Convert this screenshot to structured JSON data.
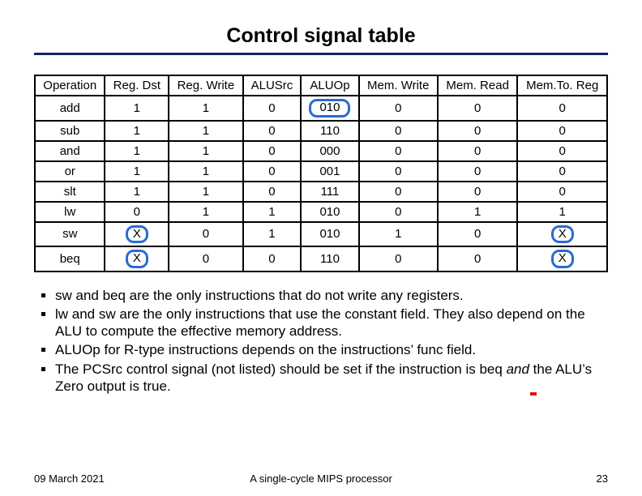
{
  "title": "Control signal table",
  "headers": [
    "Operation",
    "Reg. Dst",
    "Reg. Write",
    "ALUSrc",
    "ALUOp",
    "Mem. Write",
    "Mem. Read",
    "Mem.To. Reg"
  ],
  "rows": [
    {
      "op": "add",
      "dst": "1",
      "wr": "1",
      "src": "0",
      "aluop": "010",
      "mw": "0",
      "mr": "0",
      "m2r": "0"
    },
    {
      "op": "sub",
      "dst": "1",
      "wr": "1",
      "src": "0",
      "aluop": "110",
      "mw": "0",
      "mr": "0",
      "m2r": "0"
    },
    {
      "op": "and",
      "dst": "1",
      "wr": "1",
      "src": "0",
      "aluop": "000",
      "mw": "0",
      "mr": "0",
      "m2r": "0"
    },
    {
      "op": "or",
      "dst": "1",
      "wr": "1",
      "src": "0",
      "aluop": "001",
      "mw": "0",
      "mr": "0",
      "m2r": "0"
    },
    {
      "op": "slt",
      "dst": "1",
      "wr": "1",
      "src": "0",
      "aluop": "111",
      "mw": "0",
      "mr": "0",
      "m2r": "0"
    },
    {
      "op": "lw",
      "dst": "0",
      "wr": "1",
      "src": "1",
      "aluop": "010",
      "mw": "0",
      "mr": "1",
      "m2r": "1"
    },
    {
      "op": "sw",
      "dst": "X",
      "wr": "0",
      "src": "1",
      "aluop": "010",
      "mw": "1",
      "mr": "0",
      "m2r": "X"
    },
    {
      "op": "beq",
      "dst": "X",
      "wr": "0",
      "src": "0",
      "aluop": "110",
      "mw": "0",
      "mr": "0",
      "m2r": "X"
    }
  ],
  "bullets": [
    "sw and beq are the only instructions that do not write any registers.",
    "lw and sw are the only instructions that use the constant field. They also depend on the ALU to compute the effective memory address.",
    "ALUOp for R-type instructions depends on the instructions’ func field."
  ],
  "bullet4_pre": "The PCSrc control signal (not listed) should be set if the instruction is beq ",
  "bullet4_italic": "and",
  "bullet4_mid1": " ",
  "bullet4_red": "the ALU’s Zero output",
  "bullet4_post": " is true.",
  "footer": {
    "date": "09 March 2021",
    "center": "A single-cycle MIPS processor",
    "page": "23"
  }
}
